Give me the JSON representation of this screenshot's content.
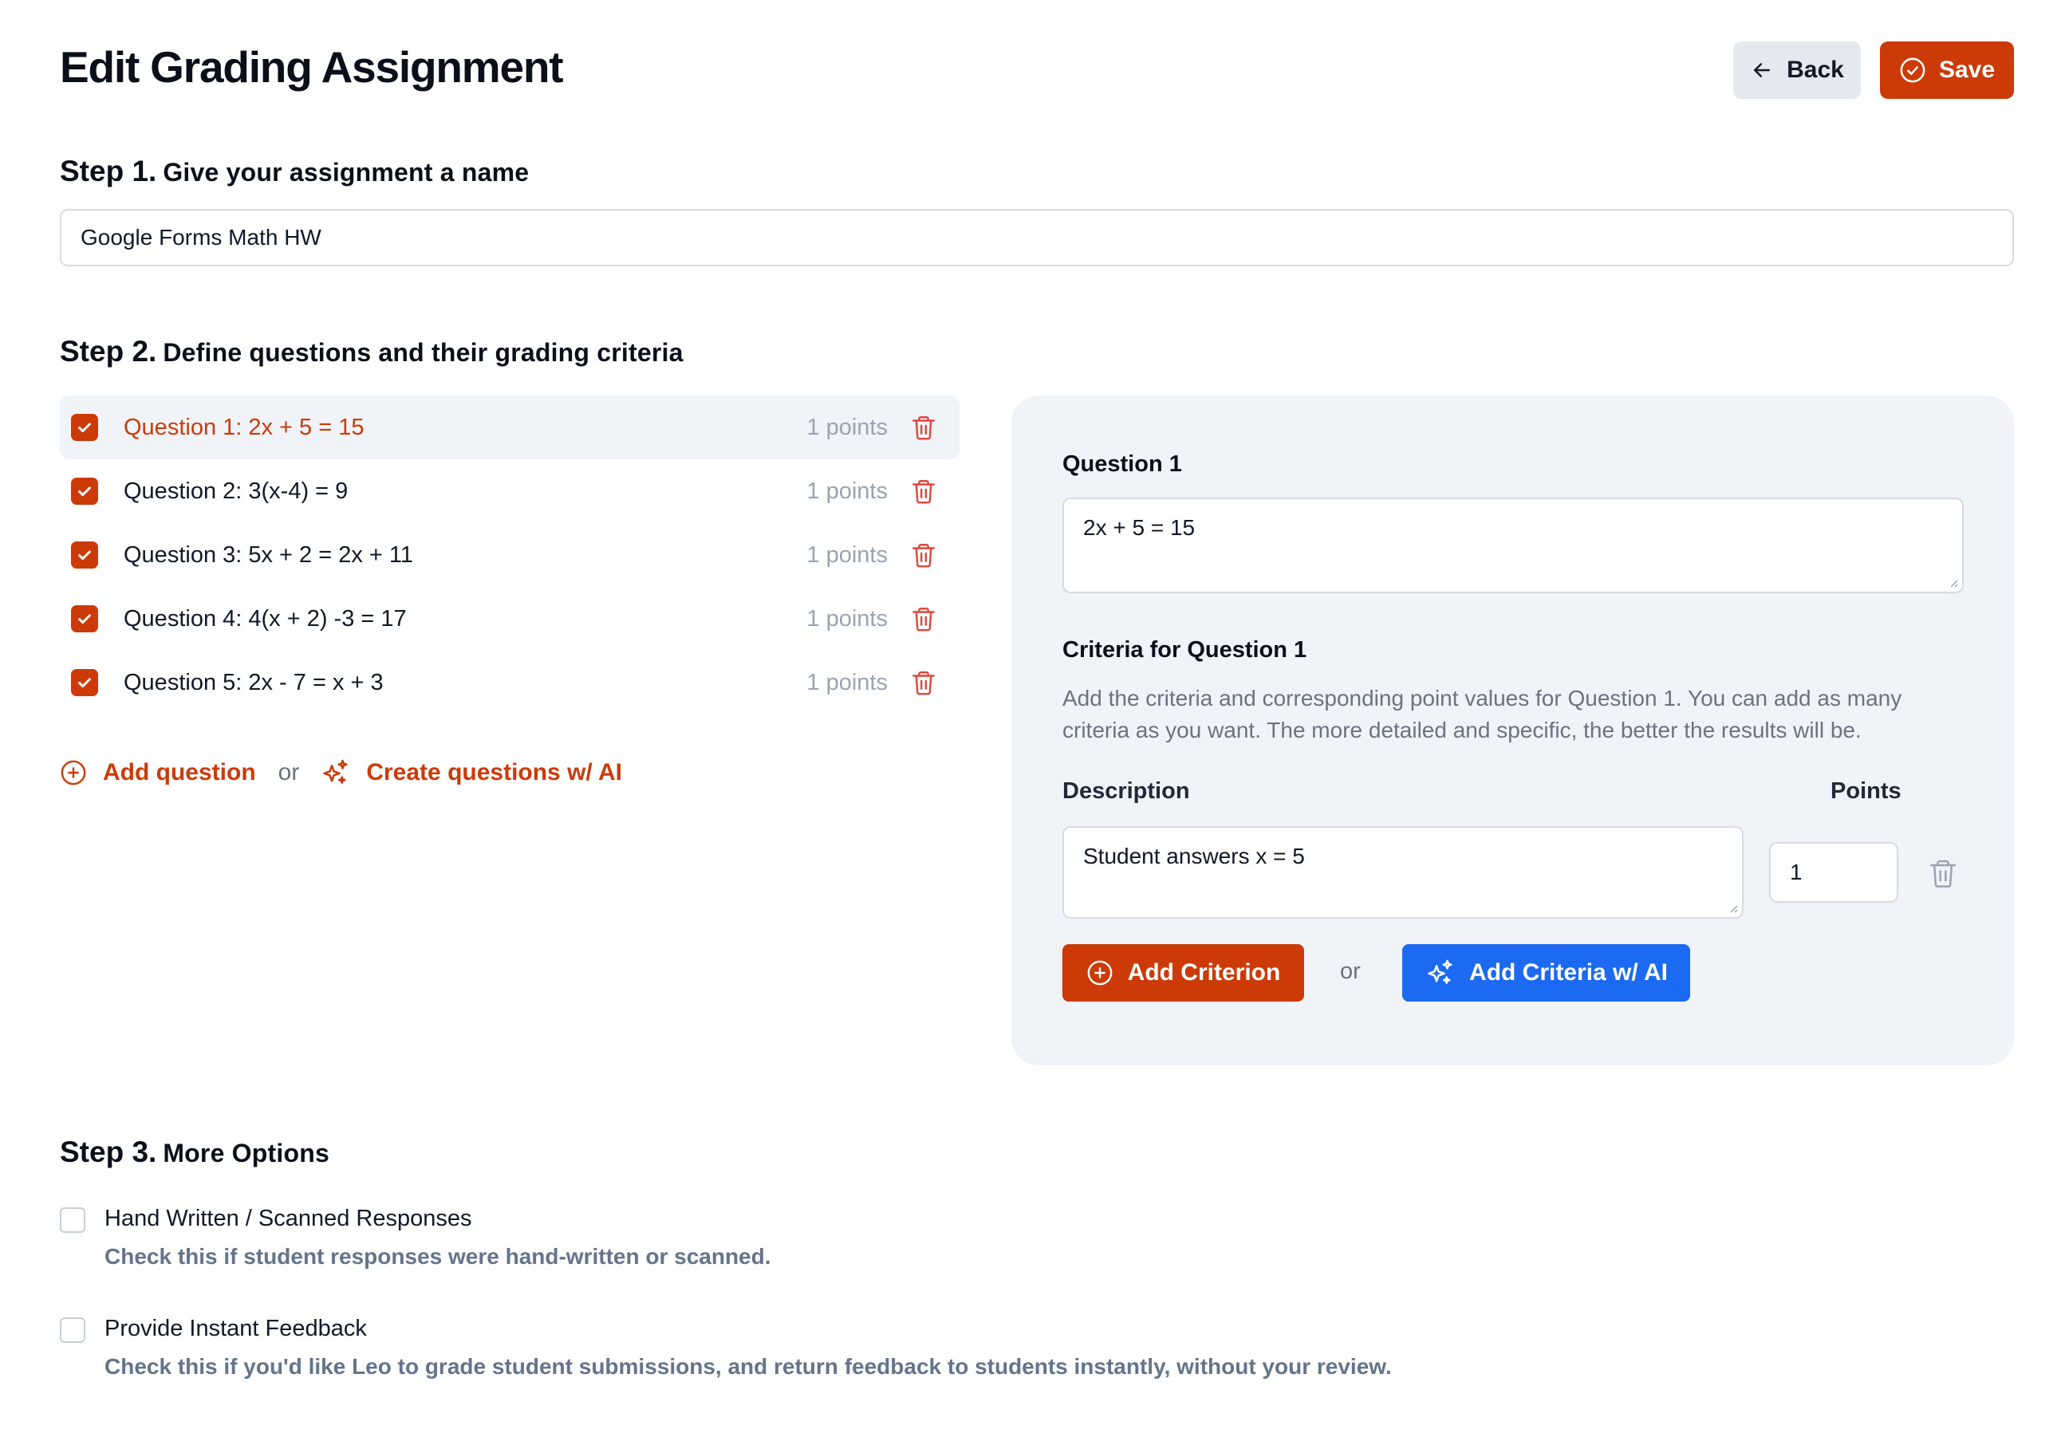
{
  "header": {
    "title": "Edit Grading Assignment",
    "back_label": "Back",
    "save_label": "Save"
  },
  "step1": {
    "num": "Step 1.",
    "text": "Give your assignment a name",
    "name_value": "Google Forms Math HW"
  },
  "step2": {
    "num": "Step 2.",
    "text": "Define questions and their grading criteria",
    "questions": [
      {
        "label": "Question 1: 2x + 5 = 15",
        "points": "1 points",
        "checked": true,
        "active": true
      },
      {
        "label": "Question 2: 3(x-4) = 9",
        "points": "1 points",
        "checked": true,
        "active": false
      },
      {
        "label": "Question 3: 5x + 2 = 2x + 11",
        "points": "1 points",
        "checked": true,
        "active": false
      },
      {
        "label": "Question 4: 4(x + 2) -3 = 17",
        "points": "1 points",
        "checked": true,
        "active": false
      },
      {
        "label": "Question 5: 2x - 7 = x + 3",
        "points": "1 points",
        "checked": true,
        "active": false
      }
    ],
    "add_question_label": "Add question",
    "or_label": "or",
    "create_ai_label": "Create questions w/ AI"
  },
  "panel": {
    "question_heading": "Question 1",
    "question_text": "2x + 5 = 15",
    "criteria_heading": "Criteria for Question 1",
    "criteria_help": "Add the criteria and corresponding point values for Question 1. You can add as many criteria as you want. The more detailed and specific, the better the results will be.",
    "description_label": "Description",
    "points_label": "Points",
    "criterion_description": "Student answers x = 5",
    "criterion_points": "1",
    "add_criterion_label": "Add Criterion",
    "or_label": "or",
    "add_ai_label": "Add Criteria w/ AI"
  },
  "step3": {
    "num": "Step 3.",
    "text": "More Options",
    "options": [
      {
        "label": "Hand Written / Scanned Responses",
        "help": "Check this if student responses were hand-written or scanned.",
        "checked": false
      },
      {
        "label": "Provide Instant Feedback",
        "help": "Check this if you'd like Leo to grade student submissions, and return feedback to students instantly, without your review.",
        "checked": false
      }
    ]
  },
  "colors": {
    "accent": "#cc3a08",
    "ai_blue": "#1d6af2",
    "panel_bg": "#f0f3f8",
    "muted": "#6b7280",
    "trash_red": "#e0473c"
  }
}
